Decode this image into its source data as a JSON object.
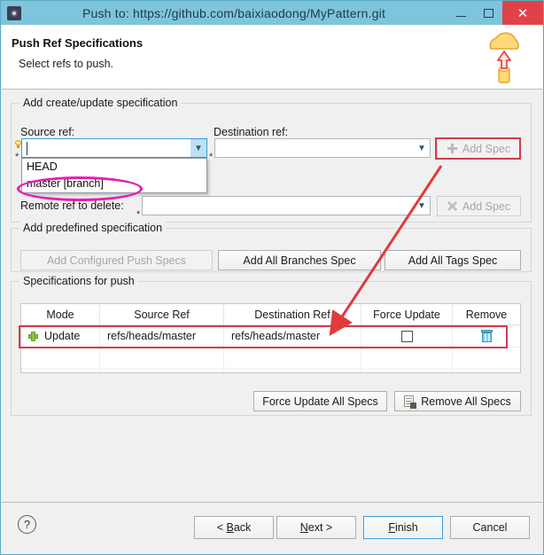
{
  "window": {
    "title": "Push to: https://github.com/baixiaodong/MyPattern.git",
    "app_icon": "gear-icon",
    "minimize_label": "–",
    "maximize_label": "□",
    "close_label": "✕"
  },
  "header": {
    "title": "Push Ref Specifications",
    "subtitle": "Select refs to push.",
    "icon": "cloud-push-icon"
  },
  "create_update_group": {
    "legend": "Add create/update specification",
    "source_label": "Source ref:",
    "destination_label": "Destination ref:",
    "source_value": "",
    "destination_value": "",
    "required_marker": "*",
    "add_spec_label": "Add Spec",
    "add_spec_icon": "plus-icon",
    "dropdown_open": true,
    "dropdown_items": [
      "HEAD",
      "master [branch]"
    ]
  },
  "delete_group": {
    "remote_ref_label": "Remote ref to delete:",
    "remote_ref_value": "",
    "required_marker": "*",
    "add_spec_label": "Add Spec",
    "add_spec_icon": "x-icon"
  },
  "predefined_group": {
    "legend": "Add predefined specification",
    "buttons": [
      {
        "label": "Add Configured Push Specs",
        "disabled": true
      },
      {
        "label": "Add All Branches Spec",
        "disabled": false
      },
      {
        "label": "Add All Tags Spec",
        "disabled": false
      }
    ]
  },
  "specs_group": {
    "legend": "Specifications for push",
    "columns": [
      "Mode",
      "Source Ref",
      "Destination Ref",
      "Force Update",
      "Remove"
    ],
    "rows": [
      {
        "mode_icon": "green-plus-icon",
        "mode": "Update",
        "source_ref": "refs/heads/master",
        "destination_ref": "refs/heads/master",
        "force_update": false,
        "remove_icon": "trash-icon",
        "highlighted": true
      }
    ],
    "empty_rows": 2,
    "force_update_all_label": "Force Update All Specs",
    "remove_all_label": "Remove All Specs",
    "remove_all_icon": "remove-document-icon"
  },
  "footer": {
    "help_icon": "question-mark-icon",
    "buttons": [
      {
        "id": "back",
        "prefix": "< ",
        "mnemonic": "B",
        "suffix": "ack",
        "default": false
      },
      {
        "id": "next",
        "prefix": "",
        "mnemonic": "N",
        "suffix": "ext >",
        "default": false
      },
      {
        "id": "finish",
        "prefix": "",
        "mnemonic": "F",
        "suffix": "inish",
        "default": true
      },
      {
        "id": "cancel",
        "prefix": "",
        "mnemonic": "",
        "suffix": "Cancel",
        "default": false
      }
    ]
  },
  "annotations": {
    "ellipse_color": "#e61fb0",
    "arrow_color": "#e03b3b",
    "rect_color": "#d23b4b"
  }
}
